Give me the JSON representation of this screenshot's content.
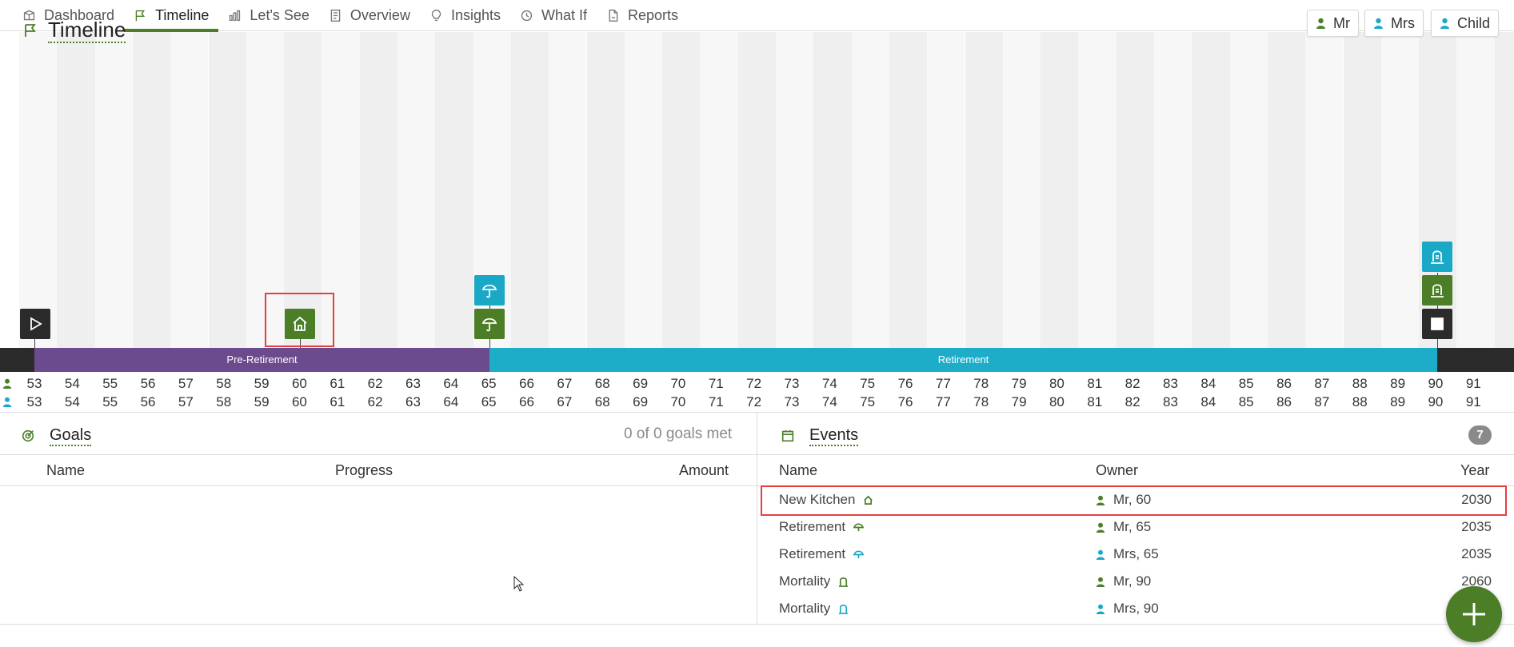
{
  "nav": {
    "tabs": [
      {
        "label": "Dashboard",
        "icon": "dashboard-icon"
      },
      {
        "label": "Timeline",
        "icon": "flag-icon",
        "active": true
      },
      {
        "label": "Let's See",
        "icon": "bar-chart-icon"
      },
      {
        "label": "Overview",
        "icon": "document-icon"
      },
      {
        "label": "Insights",
        "icon": "lightbulb-icon"
      },
      {
        "label": "What If",
        "icon": "clock-icon"
      },
      {
        "label": "Reports",
        "icon": "report-icon"
      }
    ]
  },
  "timeline": {
    "title": "Timeline",
    "legend": [
      {
        "label": "Mr",
        "color": "#4b7e26"
      },
      {
        "label": "Mrs",
        "color": "#1aa8c7"
      },
      {
        "label": "Child",
        "color": "#1aa8c7"
      }
    ],
    "phases": [
      {
        "label": "Pre-Retirement",
        "color": "#6b4a8e"
      },
      {
        "label": "Retirement",
        "color": "#1eadc9"
      }
    ],
    "ages_mr": [
      "53",
      "54",
      "55",
      "56",
      "57",
      "58",
      "59",
      "60",
      "61",
      "62",
      "63",
      "64",
      "65",
      "66",
      "67",
      "68",
      "69",
      "70",
      "71",
      "72",
      "73",
      "74",
      "75",
      "76",
      "77",
      "78",
      "79",
      "80",
      "81",
      "82",
      "83",
      "84",
      "85",
      "86",
      "87",
      "88",
      "89",
      "90",
      "91"
    ],
    "ages_mrs": [
      "53",
      "54",
      "55",
      "56",
      "57",
      "58",
      "59",
      "60",
      "61",
      "62",
      "63",
      "64",
      "65",
      "66",
      "67",
      "68",
      "69",
      "70",
      "71",
      "72",
      "73",
      "74",
      "75",
      "76",
      "77",
      "78",
      "79",
      "80",
      "81",
      "82",
      "83",
      "84",
      "85",
      "86",
      "87",
      "88",
      "89",
      "90",
      "91"
    ],
    "colors": {
      "mr": "#4b7e26",
      "mrs": "#1aa8c7",
      "dark": "#2b2b2b",
      "band": "#2b2b2b"
    }
  },
  "goals": {
    "title": "Goals",
    "summary": "0 of 0 goals met",
    "columns": [
      "Name",
      "Progress",
      "Amount"
    ]
  },
  "events": {
    "title": "Events",
    "count": "7",
    "columns": [
      "Name",
      "Owner",
      "Year"
    ],
    "rows": [
      {
        "name": "New Kitchen",
        "icon": "house-icon",
        "owner": "Mr, 60",
        "owner_color": "#4b7e26",
        "year": "2030"
      },
      {
        "name": "Retirement",
        "icon": "umbrella-icon",
        "owner": "Mr, 65",
        "owner_color": "#4b7e26",
        "year": "2035"
      },
      {
        "name": "Retirement",
        "icon": "umbrella-icon",
        "owner": "Mrs, 65",
        "owner_color": "#1aa8c7",
        "year": "2035"
      },
      {
        "name": "Mortality",
        "icon": "tombstone-icon",
        "owner": "Mr, 90",
        "owner_color": "#4b7e26",
        "year": "2060"
      },
      {
        "name": "Mortality",
        "icon": "tombstone-icon",
        "owner": "Mrs, 90",
        "owner_color": "#1aa8c7",
        "year": ""
      }
    ]
  }
}
